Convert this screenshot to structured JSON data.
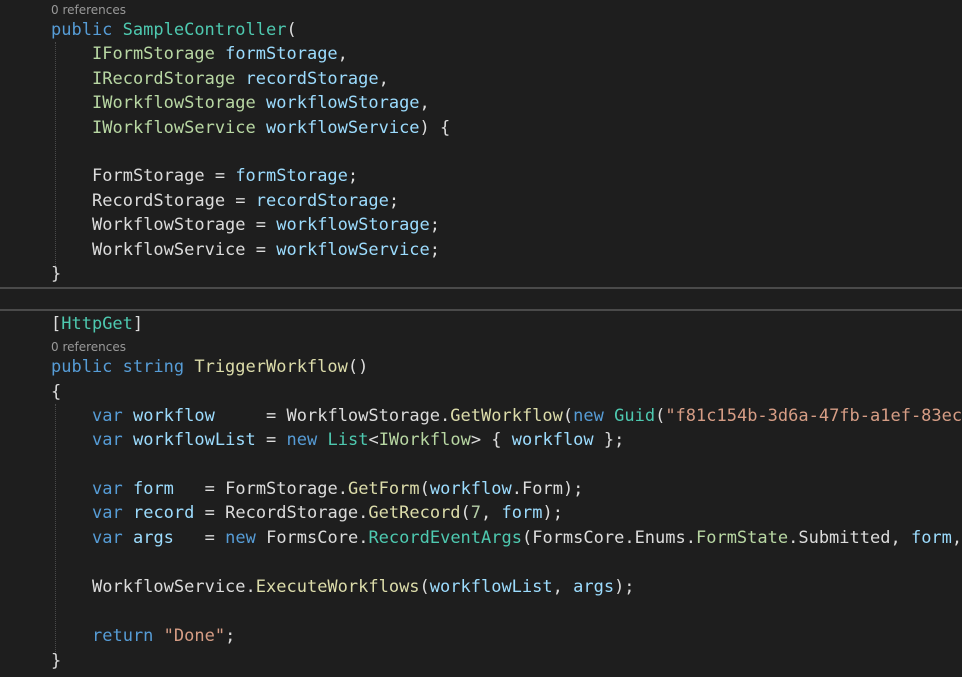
{
  "codelens": {
    "constructor": "0 references",
    "method": "0 references"
  },
  "constructor": {
    "modifier": "public",
    "name": "SampleController",
    "open_paren": "(",
    "params": [
      {
        "type": "IFormStorage",
        "name": "formStorage",
        "tail": ","
      },
      {
        "type": "IRecordStorage",
        "name": "recordStorage",
        "tail": ","
      },
      {
        "type": "IWorkflowStorage",
        "name": "workflowStorage",
        "tail": ","
      },
      {
        "type": "IWorkflowService",
        "name": "workflowService",
        "tail": ") {"
      }
    ],
    "assignments": [
      {
        "prop": "FormStorage",
        "op": " = ",
        "value": "formStorage",
        "end": ";"
      },
      {
        "prop": "RecordStorage",
        "op": " = ",
        "value": "recordStorage",
        "end": ";"
      },
      {
        "prop": "WorkflowStorage",
        "op": " = ",
        "value": "workflowStorage",
        "end": ";"
      },
      {
        "prop": "WorkflowService",
        "op": " = ",
        "value": "workflowService",
        "end": ";"
      }
    ],
    "close": "}"
  },
  "method": {
    "attr_open": "[",
    "attribute": "HttpGet",
    "attr_close": "]",
    "modifier": "public",
    "return_type": "string",
    "name": "TriggerWorkflow",
    "parens": "()",
    "open_brace": "{",
    "close_brace": "}",
    "line1": {
      "var": "var",
      "name": "workflow",
      "pad": "     = ",
      "obj": "WorkflowStorage",
      "dot": ".",
      "call": "GetWorkflow",
      "paren": "(",
      "new": "new",
      "type": "Guid",
      "paren2": "(",
      "str": "\"f81c154b-3d6a-47fb-a1ef-83ec"
    },
    "line2": {
      "var": "var",
      "name": "workflowList",
      "eq": " = ",
      "new": "new",
      "type": "List",
      "lt": "<",
      "generic": "IWorkflow",
      "rest_open": "> { ",
      "item": "workflow",
      "rest_close": " };"
    },
    "line3": {
      "var": "var",
      "name": "form",
      "pad": "   = ",
      "obj": "FormStorage",
      "dot": ".",
      "call": "GetForm",
      "paren": "(",
      "arg_obj": "workflow",
      "arg_prop": ".Form",
      "end": ");"
    },
    "line4": {
      "var": "var",
      "name": "record",
      "eq": " = ",
      "obj": "RecordStorage",
      "dot": ".",
      "call": "GetRecord",
      "paren": "(",
      "num": "7",
      "sep": ", ",
      "arg": "form",
      "end": ");"
    },
    "line5": {
      "var": "var",
      "name": "args",
      "pad": "   = ",
      "new": "new",
      "ns": "FormsCore.",
      "type": "RecordEventArgs",
      "paren": "(",
      "ns2": "FormsCore.Enums.",
      "enum": "FormState",
      "member": ".Submitted",
      "sep": ", ",
      "arg": "form",
      "tail": ","
    },
    "line6": {
      "obj": "WorkflowService",
      "dot": ".",
      "call": "ExecuteWorkflows",
      "paren": "(",
      "arg1": "workflowList",
      "sep": ", ",
      "arg2": "args",
      "end": ");"
    },
    "line7": {
      "kw": "return",
      "space": " ",
      "str": "\"Done\"",
      "end": ";"
    }
  }
}
